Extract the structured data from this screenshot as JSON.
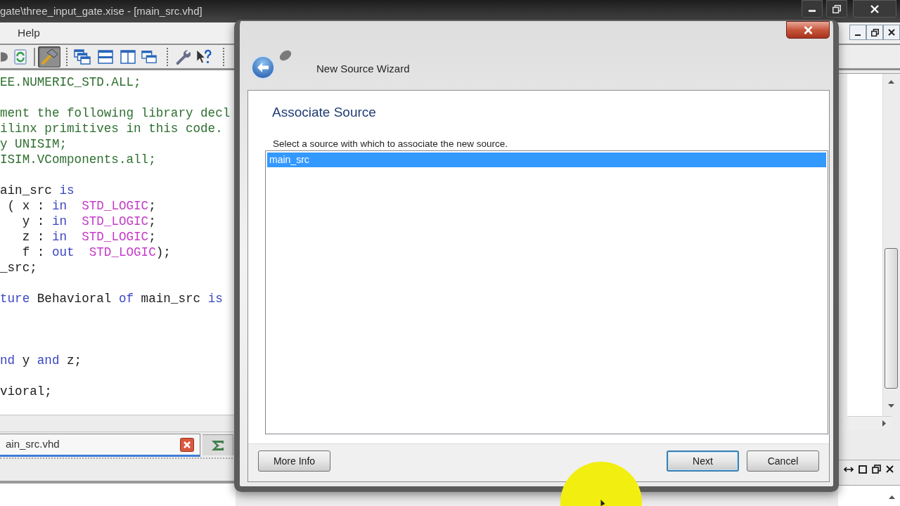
{
  "window": {
    "title": "gate\\three_input_gate.xise - [main_src.vhd]"
  },
  "menu": [
    {
      "label": "Help"
    }
  ],
  "toolbar": [
    {
      "pressed": false
    },
    {
      "pressed": false
    },
    {
      "pressed": true
    },
    {
      "pressed": false
    },
    {
      "pressed": false
    },
    {
      "pressed": false
    },
    {
      "pressed": false
    },
    {
      "pressed": false
    },
    {
      "pressed": false
    }
  ],
  "editor": {
    "lines": [
      {
        "kind": "code",
        "tokens": [
          {
            "kind": "comment",
            "text": "EE.NUMERIC_STD.ALL;"
          }
        ]
      },
      {
        "kind": "blank"
      },
      {
        "kind": "code",
        "tokens": [
          {
            "kind": "comment",
            "text": "ment the following library decl"
          }
        ]
      },
      {
        "kind": "code",
        "tokens": [
          {
            "kind": "comment",
            "text": "ilinx primitives in this code."
          }
        ]
      },
      {
        "kind": "code",
        "tokens": [
          {
            "kind": "comment",
            "text": "y UNISIM;"
          }
        ]
      },
      {
        "kind": "code",
        "tokens": [
          {
            "kind": "comment",
            "text": "ISIM.VComponents.all;"
          }
        ]
      },
      {
        "kind": "blank"
      },
      {
        "kind": "code",
        "tokens": [
          {
            "kind": "text",
            "text": "ain_src "
          },
          {
            "kind": "keyword",
            "text": "is"
          }
        ]
      },
      {
        "kind": "code",
        "tokens": [
          {
            "kind": "text",
            "text": " ( x : "
          },
          {
            "kind": "keyword",
            "text": "in"
          },
          {
            "kind": "type",
            "text": "  STD_LOGIC"
          },
          {
            "kind": "text",
            "text": ";"
          }
        ]
      },
      {
        "kind": "code",
        "tokens": [
          {
            "kind": "text",
            "text": "   y : "
          },
          {
            "kind": "keyword",
            "text": "in"
          },
          {
            "kind": "type",
            "text": "  STD_LOGIC"
          },
          {
            "kind": "text",
            "text": ";"
          }
        ]
      },
      {
        "kind": "code",
        "tokens": [
          {
            "kind": "text",
            "text": "   z : "
          },
          {
            "kind": "keyword",
            "text": "in"
          },
          {
            "kind": "type",
            "text": "  STD_LOGIC"
          },
          {
            "kind": "text",
            "text": ";"
          }
        ]
      },
      {
        "kind": "code",
        "tokens": [
          {
            "kind": "text",
            "text": "   f : "
          },
          {
            "kind": "keyword",
            "text": "out"
          },
          {
            "kind": "type",
            "text": "  STD_LOGIC"
          },
          {
            "kind": "text",
            "text": ");"
          }
        ]
      },
      {
        "kind": "code",
        "tokens": [
          {
            "kind": "text",
            "text": "_src;"
          }
        ]
      },
      {
        "kind": "blank"
      },
      {
        "kind": "code",
        "tokens": [
          {
            "kind": "keyword",
            "text": "ture"
          },
          {
            "kind": "text",
            "text": " Behavioral "
          },
          {
            "kind": "keyword",
            "text": "of"
          },
          {
            "kind": "text",
            "text": " main_src "
          },
          {
            "kind": "keyword",
            "text": "is"
          }
        ]
      },
      {
        "kind": "blank"
      },
      {
        "kind": "blank"
      },
      {
        "kind": "blank"
      },
      {
        "kind": "code",
        "tokens": [
          {
            "kind": "keyword",
            "text": "nd"
          },
          {
            "kind": "text",
            "text": " y "
          },
          {
            "kind": "keyword",
            "text": "and"
          },
          {
            "kind": "text",
            "text": " z;"
          }
        ]
      },
      {
        "kind": "blank"
      },
      {
        "kind": "code",
        "tokens": [
          {
            "kind": "text",
            "text": "vioral;"
          }
        ]
      }
    ]
  },
  "editor_tabs": [
    {
      "label": "ain_src.vhd",
      "selected": true
    },
    {
      "selected": false
    }
  ],
  "dialog": {
    "title": "New Source Wizard",
    "heading": "Associate Source",
    "instruction": "Select a source with which to associate the new source.",
    "sources": [
      {
        "label": "main_src",
        "selected": true
      }
    ],
    "buttons_left": [
      {
        "label": "More Info",
        "focused": false
      }
    ],
    "buttons_right": [
      {
        "label": "Next",
        "focused": true
      },
      {
        "label": "Cancel",
        "focused": false
      }
    ]
  }
}
